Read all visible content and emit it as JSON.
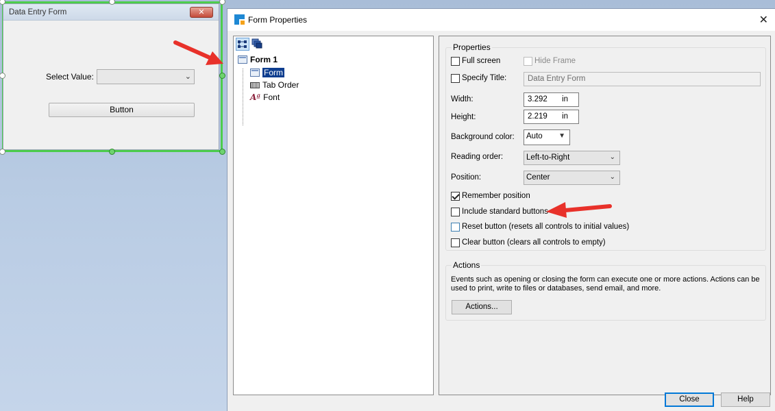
{
  "designer": {
    "window_title": "Data Entry Form",
    "close_glyph": "✕",
    "select_label": "Select Value:",
    "select_value": "",
    "button_label": "Button"
  },
  "dialog": {
    "title": "Form Properties",
    "close_glyph": "✕",
    "toolbar": [
      "tree-view-icon",
      "layers-icon"
    ],
    "tree": {
      "root": "Form 1",
      "children": [
        {
          "label": "Form",
          "icon": "form-icon",
          "selected": true
        },
        {
          "label": "Tab Order",
          "icon": "tab-order-icon",
          "selected": false
        },
        {
          "label": "Font",
          "icon": "font-icon",
          "selected": false
        }
      ]
    },
    "properties": {
      "group_title": "Properties",
      "full_screen": {
        "label": "Full screen",
        "checked": false
      },
      "hide_frame": {
        "label": "Hide Frame",
        "checked": false,
        "enabled": false
      },
      "specify_title": {
        "label": "Specify Title:",
        "checked": false,
        "value": "Data Entry Form"
      },
      "width": {
        "label": "Width:",
        "value": "3.292",
        "unit": "in"
      },
      "height": {
        "label": "Height:",
        "value": "2.219",
        "unit": "in"
      },
      "background_color": {
        "label": "Background color:",
        "value": "Auto"
      },
      "reading_order": {
        "label": "Reading order:",
        "value": "Left-to-Right"
      },
      "position": {
        "label": "Position:",
        "value": "Center"
      },
      "remember_position": {
        "label": "Remember position",
        "checked": true
      },
      "include_standard_buttons": {
        "label": "Include standard buttons",
        "checked": false
      },
      "reset_button": {
        "label": "Reset button (resets all controls to initial values)",
        "checked": false
      },
      "clear_button": {
        "label": "Clear button (clears all controls to empty)",
        "checked": false
      }
    },
    "actions": {
      "group_title": "Actions",
      "description_line1": "Events such as opening or closing the form can execute one or more actions.  Actions can be",
      "description_line2": "used to print, write to files or databases, send email, and more.",
      "button_label": "Actions..."
    },
    "footer": {
      "close_label": "Close",
      "help_label": "Help"
    }
  },
  "colors": {
    "selection_green": "#4ccd4c",
    "annotation_arrow": "#e8312a",
    "tree_selection": "#0e3e8f"
  }
}
